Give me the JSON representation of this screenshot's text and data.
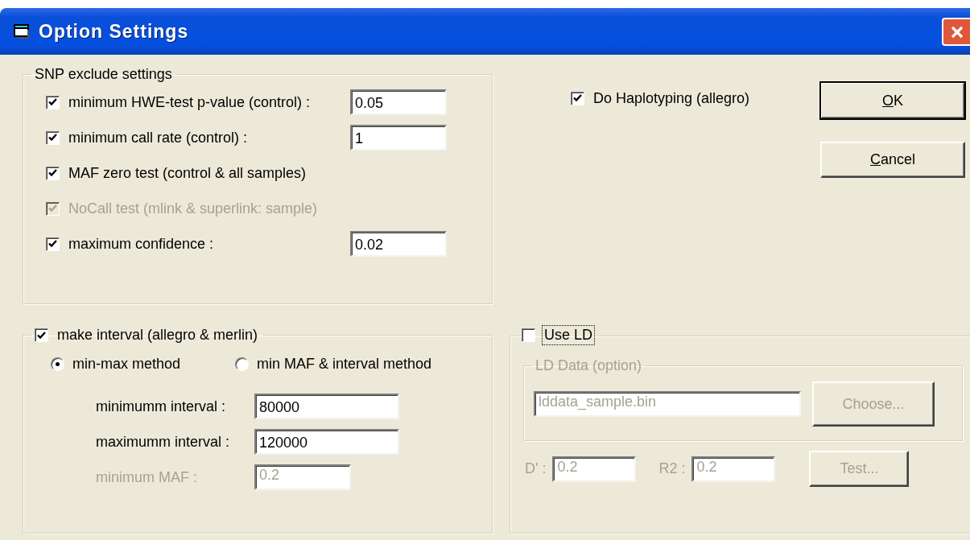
{
  "window": {
    "title": "Option Settings"
  },
  "snp_exclude": {
    "title": "SNP exclude settings",
    "options": [
      {
        "kind": "field",
        "label": "minimum HWE-test p-value (control) :",
        "checked": true,
        "disabled": false,
        "value": "0.05"
      },
      {
        "kind": "field",
        "label": "minimum call rate (control) :",
        "checked": true,
        "disabled": false,
        "value": "1"
      },
      {
        "kind": "check",
        "label": "MAF zero test (control & all samples)",
        "checked": true,
        "disabled": false
      },
      {
        "kind": "check",
        "label": "NoCall test (mlink & superlink: sample)",
        "checked": true,
        "disabled": true
      },
      {
        "kind": "field",
        "label": "maximum confidence :",
        "checked": true,
        "disabled": false,
        "value": "0.02"
      }
    ]
  },
  "haplotyping": {
    "label": "Do Haplotyping (allegro)",
    "checked": true
  },
  "buttons": [
    {
      "label": "OK"
    },
    {
      "label": "Cancel"
    }
  ],
  "interval": {
    "label": "make interval (allegro & merlin)",
    "checked": true,
    "methods": [
      {
        "label": "min-max method",
        "selected": true
      },
      {
        "label": "min MAF & interval method",
        "selected": false
      }
    ],
    "fields": [
      {
        "label": "minimumm interval :",
        "value": "80000",
        "disabled": false
      },
      {
        "label": "maximumm interval :",
        "value": "120000",
        "disabled": false
      },
      {
        "label": "minimum MAF :",
        "value": "0.2",
        "disabled": true
      }
    ]
  },
  "ld": {
    "label": "Use LD",
    "checked": false,
    "focused": true,
    "disabled": true,
    "data_group": {
      "title": "LD Data (option)",
      "file": "lddata_sample.bin",
      "button": "Choose..."
    },
    "params": [
      {
        "label": "D' :",
        "value": "0.2"
      },
      {
        "label": "R2 :",
        "value": "0.2"
      }
    ],
    "test_button": "Test..."
  }
}
